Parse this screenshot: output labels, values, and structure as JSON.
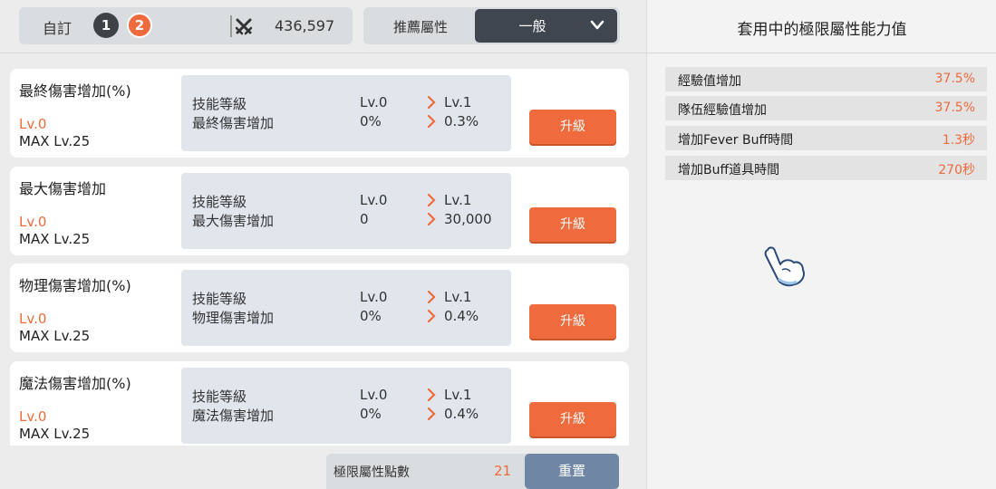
{
  "top_bar": {
    "preset_label": "自訂",
    "preset_buttons": [
      "1",
      "2"
    ],
    "combat_power": "436,597",
    "recommend_label": "推薦屬性",
    "recommend_value": "一般"
  },
  "skills": [
    {
      "title": "最終傷害增加(%)",
      "level": "Lv.0",
      "max": "MAX Lv.25",
      "row1_label": "技能等級",
      "row1_current": "Lv.0",
      "row1_next": "Lv.1",
      "row2_label": "最終傷害增加",
      "row2_current": "0%",
      "row2_next": "0.3%",
      "button": "升級"
    },
    {
      "title": "最大傷害增加",
      "level": "Lv.0",
      "max": "MAX Lv.25",
      "row1_label": "技能等級",
      "row1_current": "Lv.0",
      "row1_next": "Lv.1",
      "row2_label": "最大傷害增加",
      "row2_current": "0",
      "row2_next": "30,000",
      "button": "升級"
    },
    {
      "title": "物理傷害增加(%)",
      "level": "Lv.0",
      "max": "MAX Lv.25",
      "row1_label": "技能等級",
      "row1_current": "Lv.0",
      "row1_next": "Lv.1",
      "row2_label": "物理傷害增加",
      "row2_current": "0%",
      "row2_next": "0.4%",
      "button": "升級"
    },
    {
      "title": "魔法傷害增加(%)",
      "level": "Lv.0",
      "max": "MAX Lv.25",
      "row1_label": "技能等級",
      "row1_current": "Lv.0",
      "row1_next": "Lv.1",
      "row2_label": "魔法傷害增加",
      "row2_current": "0%",
      "row2_next": "0.4%",
      "button": "升級"
    }
  ],
  "bottom_bar": {
    "points_label": "極限屬性點數",
    "points_value": "21",
    "reset_button": "重置"
  },
  "applied_panel": {
    "title": "套用中的極限屬性能力值",
    "attributes": [
      {
        "label": "經驗值增加",
        "value": "37.5%"
      },
      {
        "label": "隊伍經驗值增加",
        "value": "37.5%"
      },
      {
        "label": "增加Fever Buff時間",
        "value": "1.3秒"
      },
      {
        "label": "增加Buff道具時間",
        "value": "270秒"
      }
    ]
  },
  "colors": {
    "accent": "#ef6a3c",
    "dark_select": "#3f4650",
    "reset_button": "#6f87a4",
    "stat_box": "#e1e5ec"
  },
  "icons": [
    "crossed-swords-icon",
    "chevron-down-icon",
    "chevron-right-icon",
    "pointer-hand-icon"
  ]
}
